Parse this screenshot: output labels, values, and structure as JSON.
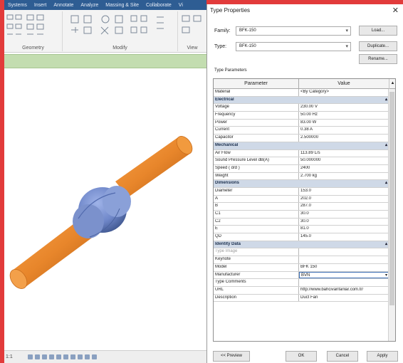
{
  "revit": {
    "ribbon_tabs": [
      "Systems",
      "Insert",
      "Annotate",
      "Analyze",
      "Massing & Site",
      "Collaborate",
      "Vi"
    ],
    "panels": {
      "geometry": "Geometry",
      "modify": "Modify",
      "view": "View"
    },
    "status_text": "1:1"
  },
  "dialog": {
    "title": "Type Properties",
    "family_label": "Family:",
    "family_value": "BFK-150",
    "type_label": "Type:",
    "type_value": "BFK-150",
    "load_button": "Load...",
    "duplicate_button": "Duplicate...",
    "rename_button": "Rename...",
    "type_parameters_label": "Type Parameters",
    "grid_headers": {
      "parameter": "Parameter",
      "value": "Value"
    },
    "rows": [
      {
        "kind": "row",
        "param": "Material",
        "value": "<By Category>"
      },
      {
        "kind": "group",
        "param": "Electrical"
      },
      {
        "kind": "row",
        "param": "Voltage",
        "value": "230.00 V"
      },
      {
        "kind": "row",
        "param": "Frequency",
        "value": "50.00 Hz"
      },
      {
        "kind": "row",
        "param": "Power",
        "value": "83.00 W"
      },
      {
        "kind": "row",
        "param": "Current",
        "value": "0.38 A"
      },
      {
        "kind": "row",
        "param": "Capacitor",
        "value": "2.500000"
      },
      {
        "kind": "group",
        "param": "Mechanical"
      },
      {
        "kind": "row",
        "param": "Air Flow",
        "value": "113.89 L/s"
      },
      {
        "kind": "row",
        "param": "Sound Pressure Level dB(A)",
        "value": "50.000000"
      },
      {
        "kind": "row",
        "param": "Speed ( d/d )",
        "value": "2400"
      },
      {
        "kind": "row",
        "param": "Weight",
        "value": "2.700 kg"
      },
      {
        "kind": "group",
        "param": "Dimensions"
      },
      {
        "kind": "row",
        "param": "Diameter",
        "value": "153.0"
      },
      {
        "kind": "row",
        "param": "A",
        "value": "202.0"
      },
      {
        "kind": "row",
        "param": "B",
        "value": "287.0"
      },
      {
        "kind": "row",
        "param": "C1",
        "value": "30.0"
      },
      {
        "kind": "row",
        "param": "C2",
        "value": "30.0"
      },
      {
        "kind": "row",
        "param": "E",
        "value": "81.0"
      },
      {
        "kind": "row",
        "param": "QD",
        "value": "145.0"
      },
      {
        "kind": "group",
        "param": "Identity Data"
      },
      {
        "kind": "row",
        "param": "Type Image",
        "value": "",
        "dim": true
      },
      {
        "kind": "row",
        "param": "Keynote",
        "value": ""
      },
      {
        "kind": "row",
        "param": "Model",
        "value": "BFK 150"
      },
      {
        "kind": "row",
        "param": "Manufacturer",
        "value": "BVN",
        "selected": true
      },
      {
        "kind": "row",
        "param": "Type Comments",
        "value": ""
      },
      {
        "kind": "row",
        "param": "URL",
        "value": "http://www.bahcivanfanlar.com.tr/"
      },
      {
        "kind": "row",
        "param": "Description",
        "value": "Duct Fan"
      }
    ],
    "buttons": {
      "preview": "<< Preview",
      "ok": "OK",
      "cancel": "Cancel",
      "apply": "Apply"
    }
  },
  "colors": {
    "accent": "#2e5d93",
    "pipe": "#e8862b",
    "fan_body": "#6f87c9",
    "frame": "#e23b3b"
  }
}
